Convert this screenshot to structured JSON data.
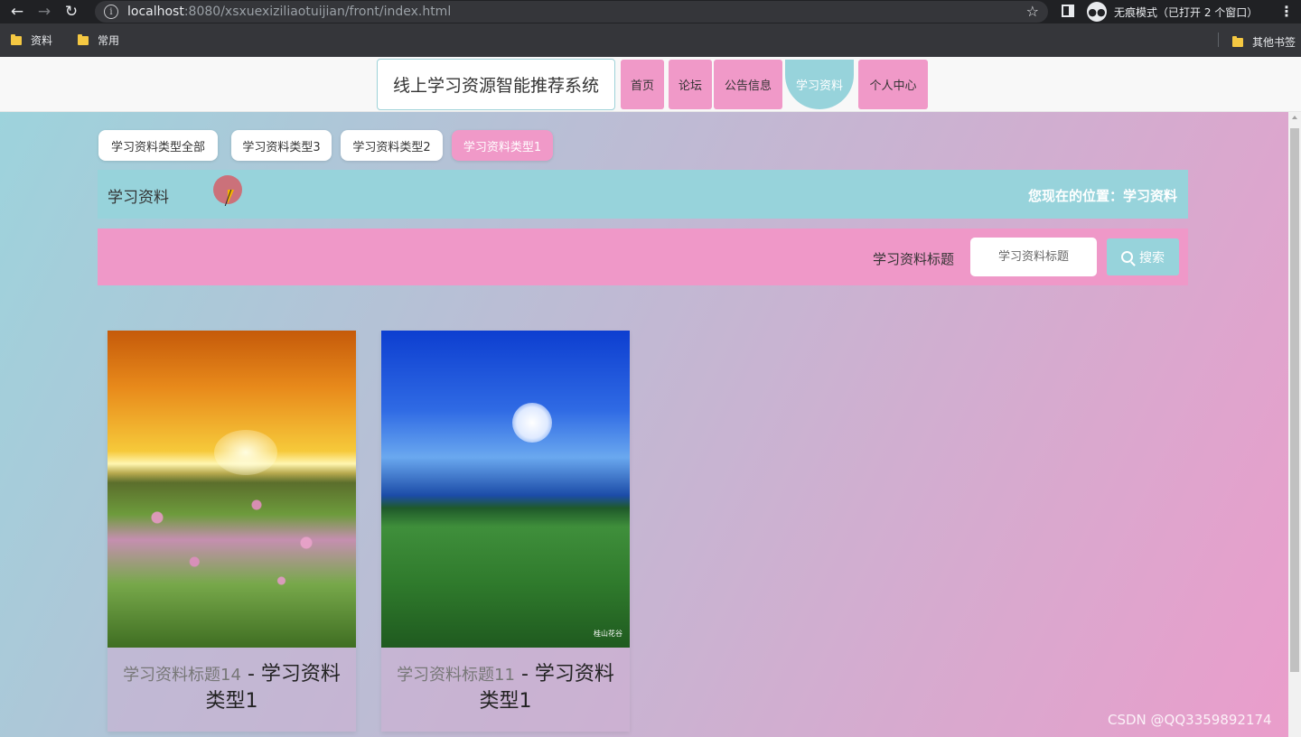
{
  "browser": {
    "url_host": "localhost",
    "url_path": ":8080/xsxuexiziliaotuijian/front/index.html",
    "incognito_label": "无痕模式（已打开 2 个窗口）",
    "incognito_icon": "incognito-icon",
    "bookmarks": [
      {
        "label": "资料",
        "icon": "folder-icon"
      },
      {
        "label": "常用",
        "icon": "folder-icon"
      }
    ],
    "other_bookmarks": "其他书签"
  },
  "header": {
    "site_title": "线上学习资源智能推荐系统",
    "nav": [
      {
        "label": "首页",
        "active": false
      },
      {
        "label": "论坛",
        "active": false
      },
      {
        "label": "公告信息",
        "active": false
      },
      {
        "label": "学习资料",
        "active": true
      },
      {
        "label": "个人中心",
        "active": false
      }
    ]
  },
  "category_tabs": [
    {
      "label": "学习资料类型全部",
      "active": false
    },
    {
      "label": "学习资料类型3",
      "active": false
    },
    {
      "label": "学习资料类型2",
      "active": false
    },
    {
      "label": "学习资料类型1",
      "active": true
    }
  ],
  "location_bar": {
    "title": "学习资料",
    "breadcrumb": "您现在的位置：学习资料"
  },
  "search": {
    "label": "学习资料标题",
    "placeholder": "学习资料标题",
    "button_label": "搜索",
    "button_icon": "search-icon"
  },
  "cards": [
    {
      "title": "学习资料标题14",
      "separator": " - ",
      "type": "学习资料类型1",
      "image": "sunset-flower-field"
    },
    {
      "title": "学习资料标题11",
      "separator": " - ",
      "type": "学习资料类型1",
      "image": "moonlit-meadow",
      "image_watermark": "桂山花谷"
    }
  ],
  "watermark": "CSDN @QQ3359892174",
  "colors": {
    "accent_teal": "#97d3db",
    "accent_pink": "#ef98c8",
    "chrome_dark": "#202124"
  }
}
